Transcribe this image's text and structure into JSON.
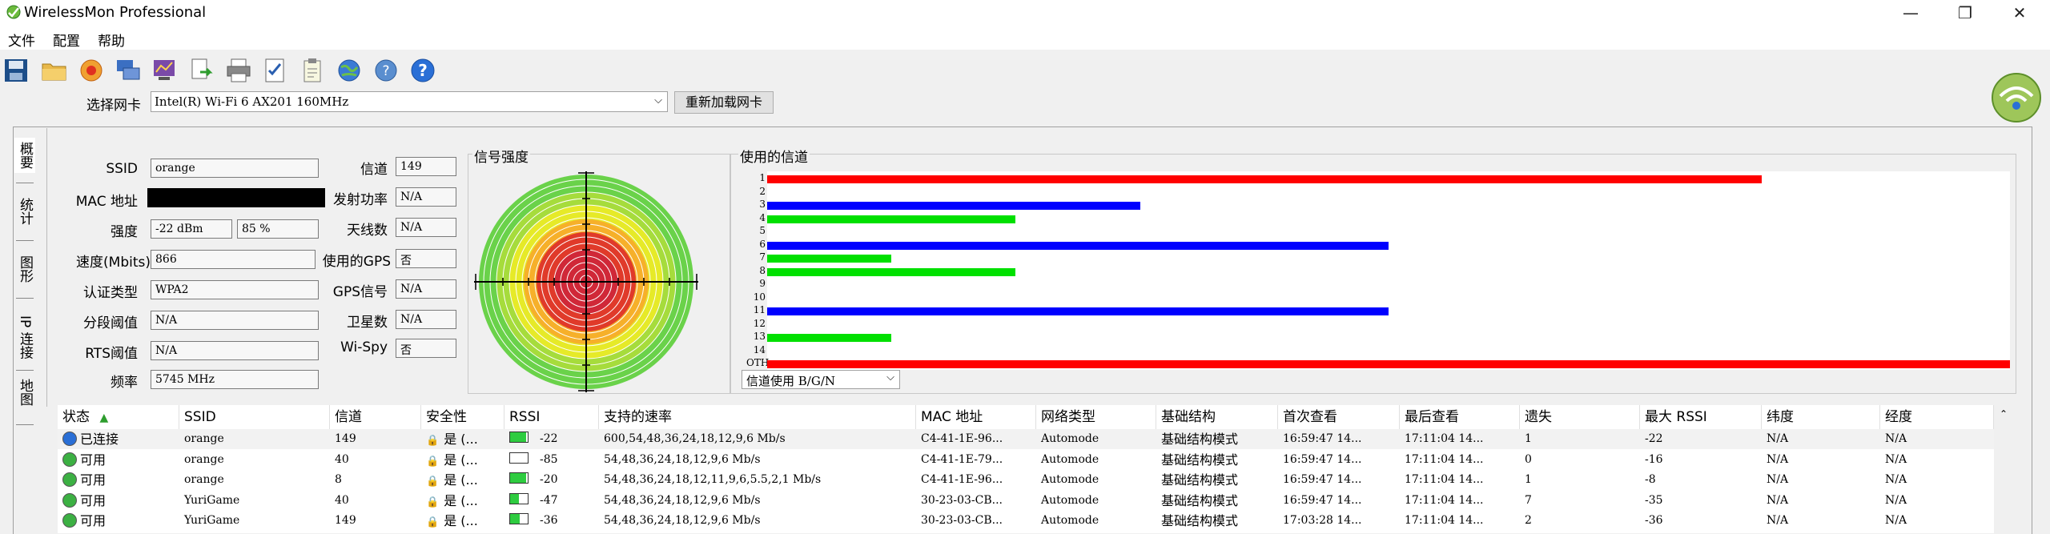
{
  "window": {
    "title": "WirelessMon Professional",
    "minimize": "—",
    "restore": "❐",
    "close": "✕"
  },
  "menu": [
    "文件",
    "配置",
    "帮助"
  ],
  "toolbar_icons": [
    "save-icon",
    "open-folder-icon",
    "record-icon",
    "network-icon",
    "graph-icon",
    "export-icon",
    "print-icon",
    "checklist-icon",
    "clipboard-icon",
    "globe-icon",
    "web-help-icon",
    "help-icon"
  ],
  "adapter": {
    "label": "选择网卡",
    "value": "Intel(R) Wi-Fi 6 AX201 160MHz",
    "reload_button": "重新加载网卡"
  },
  "side_tabs": [
    "概要",
    "统计",
    "图形",
    "IP 连接",
    "地图"
  ],
  "fields": {
    "ssid_label": "SSID",
    "ssid": "orange",
    "mac_label": "MAC 地址",
    "mac": "",
    "strength_label": "强度",
    "strength_dbm": "-22 dBm",
    "strength_pct": "85 %",
    "speed_label": "速度(Mbits)",
    "speed": "866",
    "auth_label": "认证类型",
    "auth": "WPA2",
    "frag_label": "分段阈值",
    "frag": "N/A",
    "rts_label": "RTS阈值",
    "rts": "N/A",
    "freq_label": "频率",
    "freq": "5745 MHz",
    "channel_label": "信道",
    "channel": "149",
    "txpower_label": "发射功率",
    "txpower": "N/A",
    "antenna_label": "天线数",
    "antenna": "N/A",
    "gps_used_label": "使用的GPS",
    "gps_used": "否",
    "gps_signal_label": "GPS信号",
    "gps_signal": "N/A",
    "satellites_label": "卫星数",
    "satellites": "N/A",
    "wispy_label": "Wi-Spy",
    "wispy": "否"
  },
  "signal_panel": {
    "title": "信号强度"
  },
  "channel_panel": {
    "title": "使用的信道",
    "select_value": "信道使用 B/G/N",
    "select_arrow": "⌵"
  },
  "chart_data": {
    "type": "bar",
    "orientation": "horizontal",
    "categories": [
      "1",
      "2",
      "3",
      "4",
      "5",
      "6",
      "7",
      "8",
      "9",
      "10",
      "11",
      "12",
      "13",
      "14",
      "OTH"
    ],
    "values": [
      80,
      0,
      30,
      20,
      0,
      50,
      10,
      20,
      0,
      0,
      50,
      0,
      10,
      0,
      100
    ],
    "bar_colors": [
      "#ff0000",
      "#000000",
      "#0000ff",
      "#00e000",
      "#000000",
      "#0000ff",
      "#00e000",
      "#00e000",
      "#000000",
      "#000000",
      "#0000ff",
      "#000000",
      "#00e000",
      "#000000",
      "#ff0000"
    ],
    "title": "使用的信道",
    "xlabel": "",
    "ylabel": "",
    "xlim": [
      0,
      100
    ]
  },
  "table": {
    "sort_arrow": "▲",
    "columns": [
      "状态",
      "SSID",
      "信道",
      "安全性",
      "RSSI",
      "支持的速率",
      "MAC 地址",
      "网络类型",
      "基础结构",
      "首次查看",
      "最后查看",
      "遗失",
      "最大 RSSI",
      "纬度",
      "经度"
    ],
    "rows": [
      {
        "status": "已连接",
        "status_color": "#2a6fd6",
        "ssid": "orange",
        "channel": "149",
        "security": "是 (...",
        "rssi": "-22",
        "rssi_level": 0.9,
        "rates": "600,54,48,36,24,18,12,9,6 Mb/s",
        "mac": "C4-41-1E-96...",
        "type": "Automode",
        "infra": "基础结构模式",
        "first": "16:59:47 14...",
        "last": "17:11:04 14...",
        "lost": "1",
        "max_rssi": "-22",
        "lat": "N/A",
        "lon": "N/A"
      },
      {
        "status": "可用",
        "status_color": "#3cb043",
        "ssid": "orange",
        "channel": "40",
        "security": "是 (...",
        "rssi": "-85",
        "rssi_level": 0.0,
        "rates": "54,48,36,24,18,12,9,6 Mb/s",
        "mac": "C4-41-1E-79...",
        "type": "Automode",
        "infra": "基础结构模式",
        "first": "16:59:47 14...",
        "last": "17:11:04 14...",
        "lost": "0",
        "max_rssi": "-16",
        "lat": "N/A",
        "lon": "N/A"
      },
      {
        "status": "可用",
        "status_color": "#3cb043",
        "ssid": "orange",
        "channel": "8",
        "security": "是 (...",
        "rssi": "-20",
        "rssi_level": 0.9,
        "rates": "54,48,36,24,18,12,11,9,6,5.5,2,1 Mb/s",
        "mac": "C4-41-1E-96...",
        "type": "Automode",
        "infra": "基础结构模式",
        "first": "16:59:47 14...",
        "last": "17:11:04 14...",
        "lost": "1",
        "max_rssi": "-8",
        "lat": "N/A",
        "lon": "N/A"
      },
      {
        "status": "可用",
        "status_color": "#3cb043",
        "ssid": "YuriGame",
        "channel": "40",
        "security": "是 (...",
        "rssi": "-47",
        "rssi_level": 0.5,
        "rates": "54,48,36,24,18,12,9,6 Mb/s",
        "mac": "30-23-03-CB...",
        "type": "Automode",
        "infra": "基础结构模式",
        "first": "16:59:47 14...",
        "last": "17:11:04 14...",
        "lost": "7",
        "max_rssi": "-35",
        "lat": "N/A",
        "lon": "N/A"
      },
      {
        "status": "可用",
        "status_color": "#3cb043",
        "ssid": "YuriGame",
        "channel": "149",
        "security": "是 (...",
        "rssi": "-36",
        "rssi_level": 0.55,
        "rates": "54,48,36,24,18,12,9,6 Mb/s",
        "mac": "30-23-03-CB...",
        "type": "Automode",
        "infra": "基础结构模式",
        "first": "17:03:28 14...",
        "last": "17:11:04 14...",
        "lost": "2",
        "max_rssi": "-36",
        "lat": "N/A",
        "lon": "N/A"
      }
    ]
  }
}
